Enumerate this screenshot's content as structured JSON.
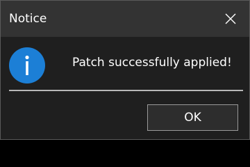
{
  "window": {
    "title": "Notice",
    "close_icon": "close-icon"
  },
  "body": {
    "icon": "info-icon",
    "icon_color": "#1c7fd6",
    "message": "Patch successfully applied!"
  },
  "footer": {
    "ok_label": "OK"
  }
}
